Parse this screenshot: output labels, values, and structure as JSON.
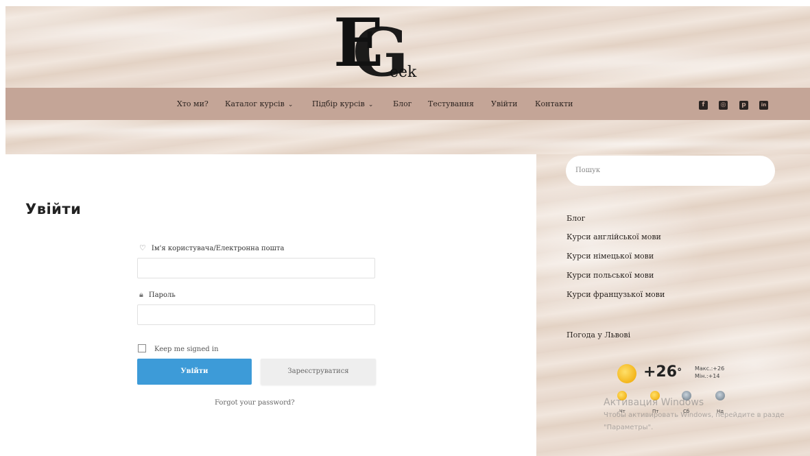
{
  "logo": {
    "letter_e": "E",
    "letter_g": "G",
    "tail": "eek"
  },
  "nav": {
    "items": [
      {
        "label": "Хто ми?",
        "dropdown": false
      },
      {
        "label": "Каталог курсів",
        "dropdown": true
      },
      {
        "label": "Підбір курсів",
        "dropdown": true
      },
      {
        "label": "Блог",
        "dropdown": false
      },
      {
        "label": "Тестування",
        "dropdown": false
      },
      {
        "label": "Увійти",
        "dropdown": false
      },
      {
        "label": "Контакти",
        "dropdown": false
      }
    ],
    "chevron": "⌄",
    "social": [
      {
        "icon": "facebook-icon",
        "glyph": "f"
      },
      {
        "icon": "instagram-icon",
        "glyph": "◎"
      },
      {
        "icon": "pinterest-icon",
        "glyph": "p"
      },
      {
        "icon": "linkedin-icon",
        "glyph": "in"
      }
    ],
    "bg_color": "#c4a597"
  },
  "login": {
    "title": "Увійти",
    "username_label": "Ім'я користувача/Електронна пошта",
    "username_value": "",
    "password_label": "Пароль",
    "password_value": "",
    "remember_label": "Keep me signed in",
    "remember_checked": false,
    "login_button": "Увійти",
    "register_button": "Зареєструватися",
    "forgot_link": "Forgot your password?",
    "accent": "#3d9bd8"
  },
  "sidebar": {
    "search_placeholder": "Пошук",
    "links": [
      "Блог",
      "Курси англійської мови",
      "Курси німецької мови",
      "Курси польської мови",
      "Курси французької мови"
    ],
    "weather": {
      "title": "Погода у Львові",
      "temp": "+26",
      "unit": "°",
      "max": "Макс.:+26",
      "min": "Мін.:+14",
      "forecast": [
        {
          "day": "Чт",
          "icon": "sun-icon"
        },
        {
          "day": "Пт",
          "icon": "sun-icon"
        },
        {
          "day": "Сб",
          "icon": "cloud-icon"
        },
        {
          "day": "Нд",
          "icon": "cloud-icon"
        }
      ]
    }
  },
  "watermark": {
    "line1": "Активация Windows",
    "line2": "Чтобы активировать Windows, перейдите в разде",
    "line3": "\"Параметры\"."
  }
}
